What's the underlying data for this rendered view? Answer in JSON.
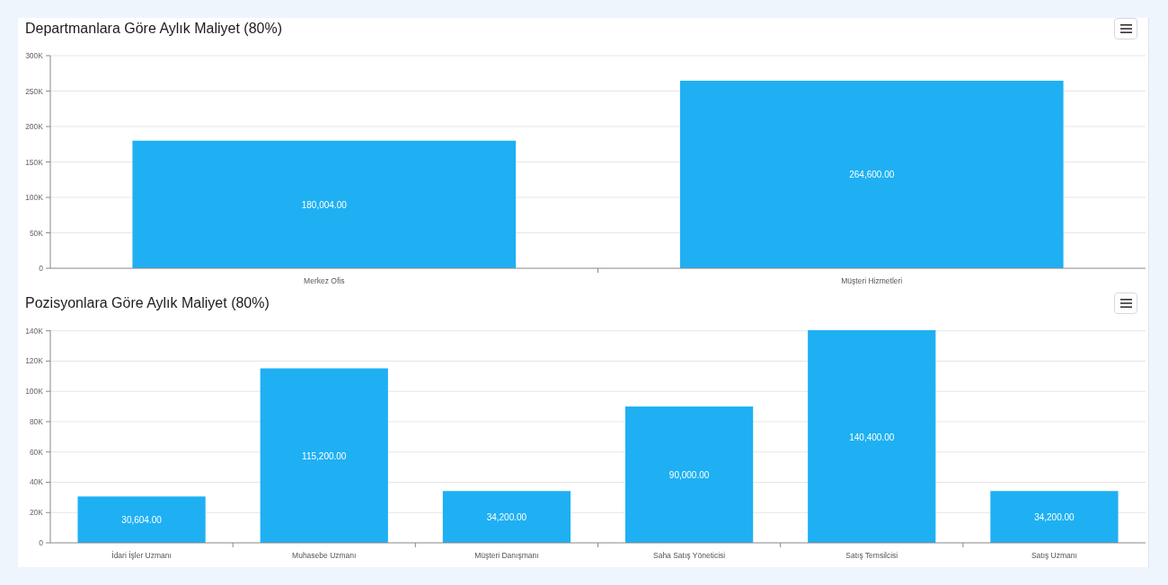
{
  "charts": [
    {
      "title": "Departmanlara Göre Aylık Maliyet (80%)",
      "chart_data": {
        "type": "bar",
        "categories": [
          "Merkez Ofis",
          "Müşteri Hizmetleri"
        ],
        "series": [
          {
            "color": "#1eb0f3",
            "values": [
              180004,
              264600
            ]
          }
        ],
        "grid": true,
        "ylim": [
          0,
          300000
        ],
        "yticks": [
          {
            "value": 0,
            "label": "0"
          },
          {
            "value": 50000,
            "label": "50K"
          },
          {
            "value": 100000,
            "label": "100K"
          },
          {
            "value": 150000,
            "label": "150K"
          },
          {
            "value": 200000,
            "label": "200K"
          },
          {
            "value": 250000,
            "label": "250K"
          },
          {
            "value": 300000,
            "label": "300K"
          }
        ],
        "value_labels": [
          "180,004.00",
          "264,600.00"
        ]
      }
    },
    {
      "title": "Pozisyonlara Göre Aylık Maliyet (80%)",
      "chart_data": {
        "type": "bar",
        "categories": [
          "İdari İşler Uzmanı",
          "Muhasebe Uzmanı",
          "Müşteri Danışmanı",
          "Saha Satış Yöneticisi",
          "Satış Temsilcisi",
          "Satış Uzmanı"
        ],
        "series": [
          {
            "color": "#1eb0f3",
            "values": [
              30604,
              115200,
              34200,
              90000,
              140400,
              34200
            ]
          }
        ],
        "grid": true,
        "ylim": [
          0,
          140400
        ],
        "yticks": [
          {
            "value": 0,
            "label": "0"
          },
          {
            "value": 20000,
            "label": "20K"
          },
          {
            "value": 40000,
            "label": "40K"
          },
          {
            "value": 60000,
            "label": "60K"
          },
          {
            "value": 80000,
            "label": "80K"
          },
          {
            "value": 100000,
            "label": "100K"
          },
          {
            "value": 120000,
            "label": "120K"
          },
          {
            "value": 140000,
            "label": "140K"
          }
        ],
        "value_labels": [
          "30,604.00",
          "115,200.00",
          "34,200.00",
          "90,000.00",
          "140,400.00",
          "34,200.00"
        ]
      }
    }
  ]
}
